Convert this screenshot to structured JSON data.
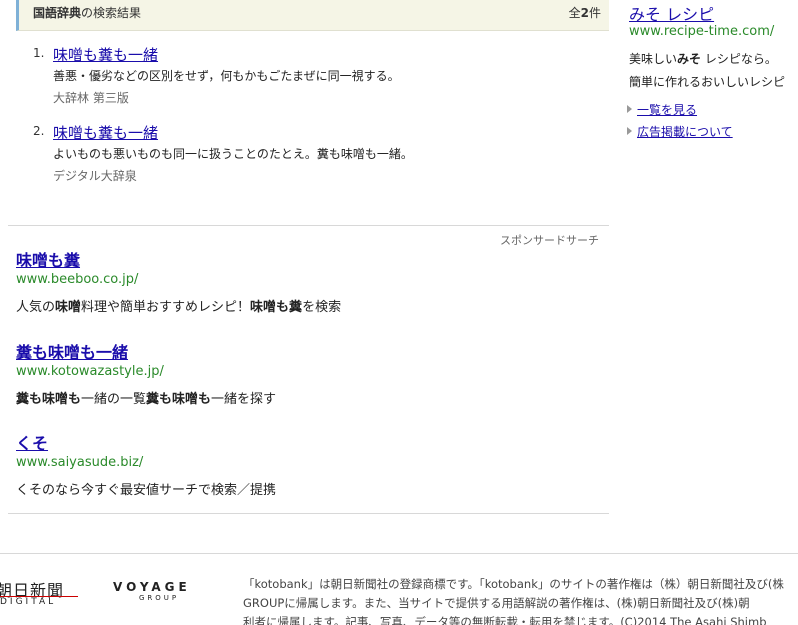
{
  "dictionary": {
    "header_title_bold": "国語辞典",
    "header_title_rest": "の検索結果",
    "count_prefix": "全",
    "count_num": "2",
    "count_suffix": "件",
    "results": [
      {
        "num": "1.",
        "title": "味噌も糞も一緒",
        "desc": "善悪・優劣などの区別をせず，何もかもごたまぜに同一視する。",
        "source": "大辞林 第三版"
      },
      {
        "num": "2.",
        "title": "味噌も糞も一緒",
        "desc": "よいものも悪いものも同一に扱うことのたとえ。糞も味噌も一緒。",
        "source": "デジタル大辞泉"
      }
    ]
  },
  "sponsored": {
    "label": "スポンサードサーチ",
    "ads": [
      {
        "title": "味噌も糞",
        "url": "www.beeboo.co.jp/",
        "desc": [
          {
            "t": "人気の",
            "b": false
          },
          {
            "t": "味噌",
            "b": true
          },
          {
            "t": "料理や簡単おすすめレシピ！",
            "b": false
          },
          {
            "t": "味噌も糞",
            "b": true
          },
          {
            "t": "を検索",
            "b": false
          }
        ]
      },
      {
        "title": "糞も味噌も一緒",
        "url": "www.kotowazastyle.jp/",
        "desc": [
          {
            "t": "糞も味噌も",
            "b": true
          },
          {
            "t": "一緒の一覧",
            "b": false
          },
          {
            "t": "糞も味噌も",
            "b": true
          },
          {
            "t": "一緒を探す",
            "b": false
          }
        ]
      },
      {
        "title": "くそ",
        "url": "www.saiyasude.biz/",
        "desc": [
          {
            "t": "くそのなら今すぐ最安値サーチで検索／提携",
            "b": false
          }
        ]
      }
    ]
  },
  "right_ad": {
    "title": "みそ レシピ",
    "url": "www.recipe-time.com/",
    "desc1": [
      {
        "t": "美味しい",
        "b": false
      },
      {
        "t": "みそ",
        "b": true
      },
      {
        "t": " レシピなら。",
        "b": false
      }
    ],
    "desc2": "簡単に作れるおいしいレシピ",
    "links": [
      "一覧を見る",
      "広告掲載について"
    ]
  },
  "footer": {
    "asahi_logo_text": "朝日新聞",
    "asahi_logo_sub": "DIGITAL",
    "voyage_logo_text": "VOYAGE",
    "voyage_logo_sub": "GROUP",
    "lines": [
      "「kotobank」は朝日新聞社の登録商標です。「kotobank」のサイトの著作権は（株）朝日新聞社及び(株",
      "GROUPに帰属します。また、当サイトで提供する用語解説の著作権は、(株)朝日新聞社及び(株)朝",
      "利者に帰属します。記事、写真、データ等の無断転載・転用を禁じます。(C)2014 The Asahi Shimb"
    ]
  }
}
